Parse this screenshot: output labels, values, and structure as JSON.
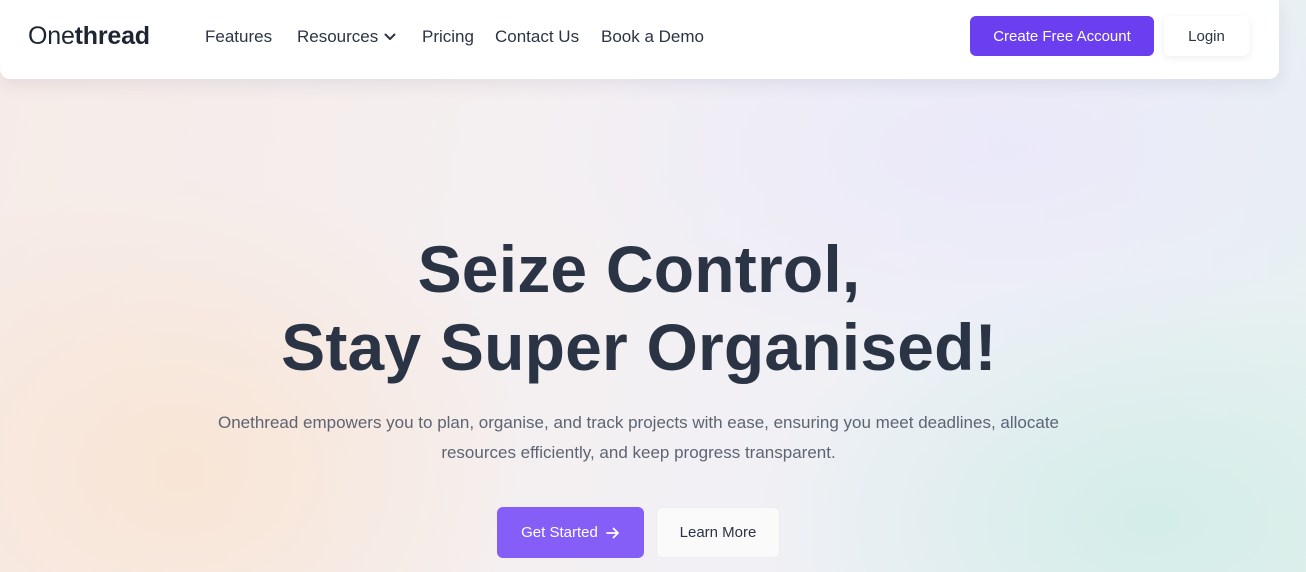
{
  "brand": {
    "name_light": "One",
    "name_bold": "thread"
  },
  "nav": {
    "features": "Features",
    "resources": "Resources",
    "pricing": "Pricing",
    "contact": "Contact Us",
    "demo": "Book a Demo"
  },
  "header_actions": {
    "create_account": "Create Free Account",
    "login": "Login"
  },
  "hero": {
    "title_line1": "Seize Control,",
    "title_line2": "Stay Super Organised!",
    "description": "Onethread empowers you to plan, organise, and track projects with ease, ensuring you meet deadlines, allocate resources efficiently, and keep progress transparent.",
    "cta_primary": "Get Started",
    "cta_secondary": "Learn More"
  },
  "icons": {
    "resources_dropdown": "chevron-down-icon",
    "cta_arrow": "arrow-right-icon"
  },
  "colors": {
    "accent": "#6b3ef0",
    "cta": "#845ef7",
    "text_dark": "#2b3445"
  }
}
